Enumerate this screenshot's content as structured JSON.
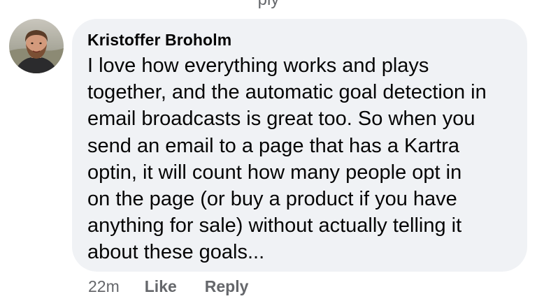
{
  "top_partial_text": "ply",
  "comment": {
    "author": "Kristoffer Broholm",
    "avatar_icon": "user-avatar-photo",
    "lines": [
      "I love how everything works and plays",
      "together, and the automatic goal detection in",
      "email broadcasts is great too. So when you",
      "send an email to a page that has a Kartra",
      "optin, it will count how many people opt in",
      "on the page (or buy a product if you have",
      "anything for sale) without actually telling it",
      "about these goals..."
    ],
    "bubble_color": "#f0f2f5",
    "text_color": "#050505"
  },
  "actions": {
    "timestamp": "22m",
    "like_label": "Like",
    "reply_label": "Reply",
    "color": "#65676b"
  }
}
